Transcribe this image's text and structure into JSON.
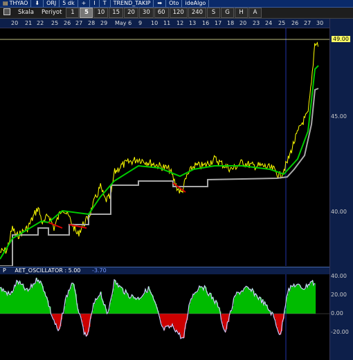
{
  "topbar": {
    "symbol": "THYAO",
    "down_arrow": "⬇",
    "orj": "ORJ",
    "period": "5 dk",
    "plus": "+",
    "cursor": "I",
    "text_tool": "T",
    "strategy": "TREND_TAKIP",
    "right_arrow": "➡",
    "oto": "Oto",
    "idealgo": "ideAlgo"
  },
  "toolbar": {
    "scale_label": "Skala",
    "period_label": "Periyot",
    "periods": [
      "1",
      "5",
      "10",
      "15",
      "20",
      "30",
      "60",
      "120",
      "240",
      "S",
      "G",
      "H",
      "A"
    ],
    "active_period": "5"
  },
  "dates": [
    "20",
    "21",
    "22",
    "25",
    "26",
    "27",
    "28",
    "29",
    "May 6",
    "9",
    "10",
    "11",
    "12",
    "13",
    "16",
    "17",
    "18",
    "20",
    "23",
    "24",
    "25",
    "26",
    "27",
    "30"
  ],
  "price_axis": {
    "labels": [
      "49.00",
      "45.00",
      "40.00"
    ],
    "highlight": "49.00"
  },
  "oscillator": {
    "p_label": "P",
    "name": "AET_OSCILLATOR : 5.00",
    "value": "-3.70",
    "labels": [
      "40.00",
      "20.00",
      "0.00",
      "-20.00"
    ]
  },
  "colors": {
    "price": "#ffff00",
    "trend_green": "#00cc00",
    "trend_red": "#dd0000",
    "stop_line": "#aaaaaa",
    "osc_pos": "#00bb00",
    "osc_neg": "#cc0000",
    "osc_line": "#ccccff"
  }
}
